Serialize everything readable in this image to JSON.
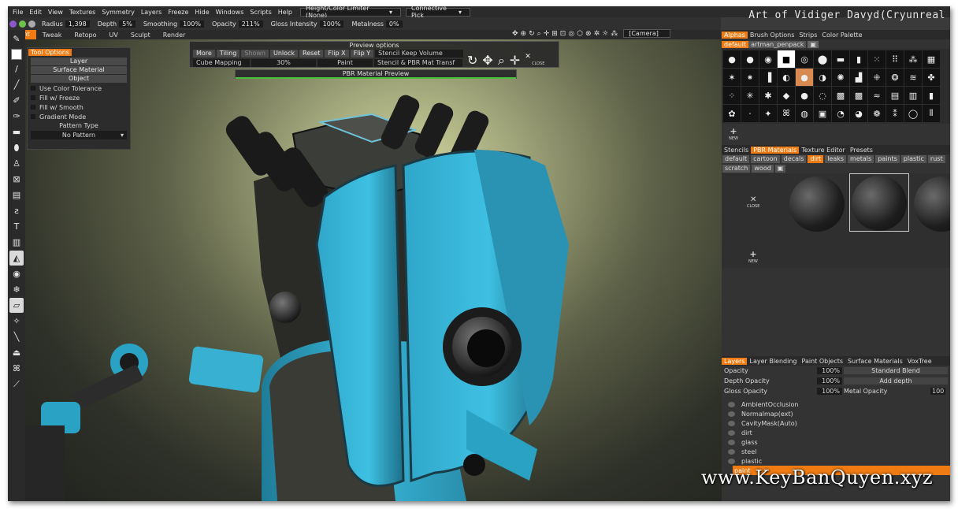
{
  "window": {
    "title": "Art of Vidiger Davyd(Cryunreal"
  },
  "menu": {
    "items": [
      "File",
      "Edit",
      "View",
      "Textures",
      "Symmetry",
      "Layers",
      "Freeze",
      "Hide",
      "Windows",
      "Scripts",
      "Help"
    ],
    "limiter": "Height/Color Limiter (None)",
    "pick": "Connective Pick"
  },
  "toolbar": {
    "radius_label": "Radius",
    "radius": "1,398",
    "depth_label": "Depth",
    "depth": "5%",
    "smoothing_label": "Smoothing",
    "smoothing": "100%",
    "opacity_label": "Opacity",
    "opacity": "211%",
    "gloss_label": "Gloss Intensity",
    "gloss": "100%",
    "metalness_label": "Metalness",
    "metalness": "0%"
  },
  "rooms": [
    "Paint",
    "Tweak",
    "Retopo",
    "UV",
    "Sculpt",
    "Render"
  ],
  "camera": "[Camera]",
  "tool_options": {
    "header": "Tool Options",
    "buttons": [
      "Layer",
      "Surface Material",
      "Object"
    ],
    "checks": [
      "Use Color Tolerance",
      "Fill w/ Freeze",
      "Fill w/ Smooth",
      "Gradient Mode"
    ],
    "pattern_label": "Pattern Type",
    "pattern_value": "No Pattern"
  },
  "preview": {
    "title": "Preview options",
    "row1": [
      "More",
      "Tiling",
      "Shown",
      "Unlock",
      "Reset",
      "Flip X",
      "Flip Y"
    ],
    "stencil_volume": "Stencil Keep Volume",
    "cube_mapping": "Cube Mapping",
    "percent": "30%",
    "paint": "Paint",
    "stencil_pbr": "Stencil & PBR Mat Transf",
    "close": "CLOSE",
    "pbr_bar": "PBR Material Preview"
  },
  "alphas": {
    "tabs": [
      "Alphas",
      "Brush Options",
      "Strips",
      "Color Palette"
    ],
    "sets": [
      "default",
      "artman_penpack"
    ],
    "new": "NEW"
  },
  "materials": {
    "tabs": [
      "Stencils",
      "PBR Materials",
      "Texture Editor",
      "Presets"
    ],
    "categories": [
      "default",
      "cartoon",
      "decals",
      "dirt",
      "leaks",
      "metals",
      "paints",
      "plastic",
      "rust",
      "scratch",
      "wood"
    ],
    "active_category": "dirt",
    "close": "CLOSE",
    "new": "NEW"
  },
  "layers": {
    "tabs": [
      "Layers",
      "Layer Blending",
      "Paint Objects",
      "Surface Materials",
      "VoxTree"
    ],
    "opacity_label": "Opacity",
    "opacity": "100%",
    "blend": "Standard Blend",
    "depth_label": "Depth Opacity",
    "depth": "100%",
    "add_depth": "Add depth",
    "gloss_label": "Gloss Opacity",
    "gloss": "100%",
    "metal_label": "Metal Opacity",
    "metal": "100",
    "items": [
      "AmbientOcclusion",
      "Normalmap(ext)",
      "CavityMask(Auto)",
      "dirt",
      "glass",
      "steel",
      "plastic",
      "paint"
    ],
    "active": "paint"
  },
  "watermark": "www.KeyBanQuyen.xyz"
}
